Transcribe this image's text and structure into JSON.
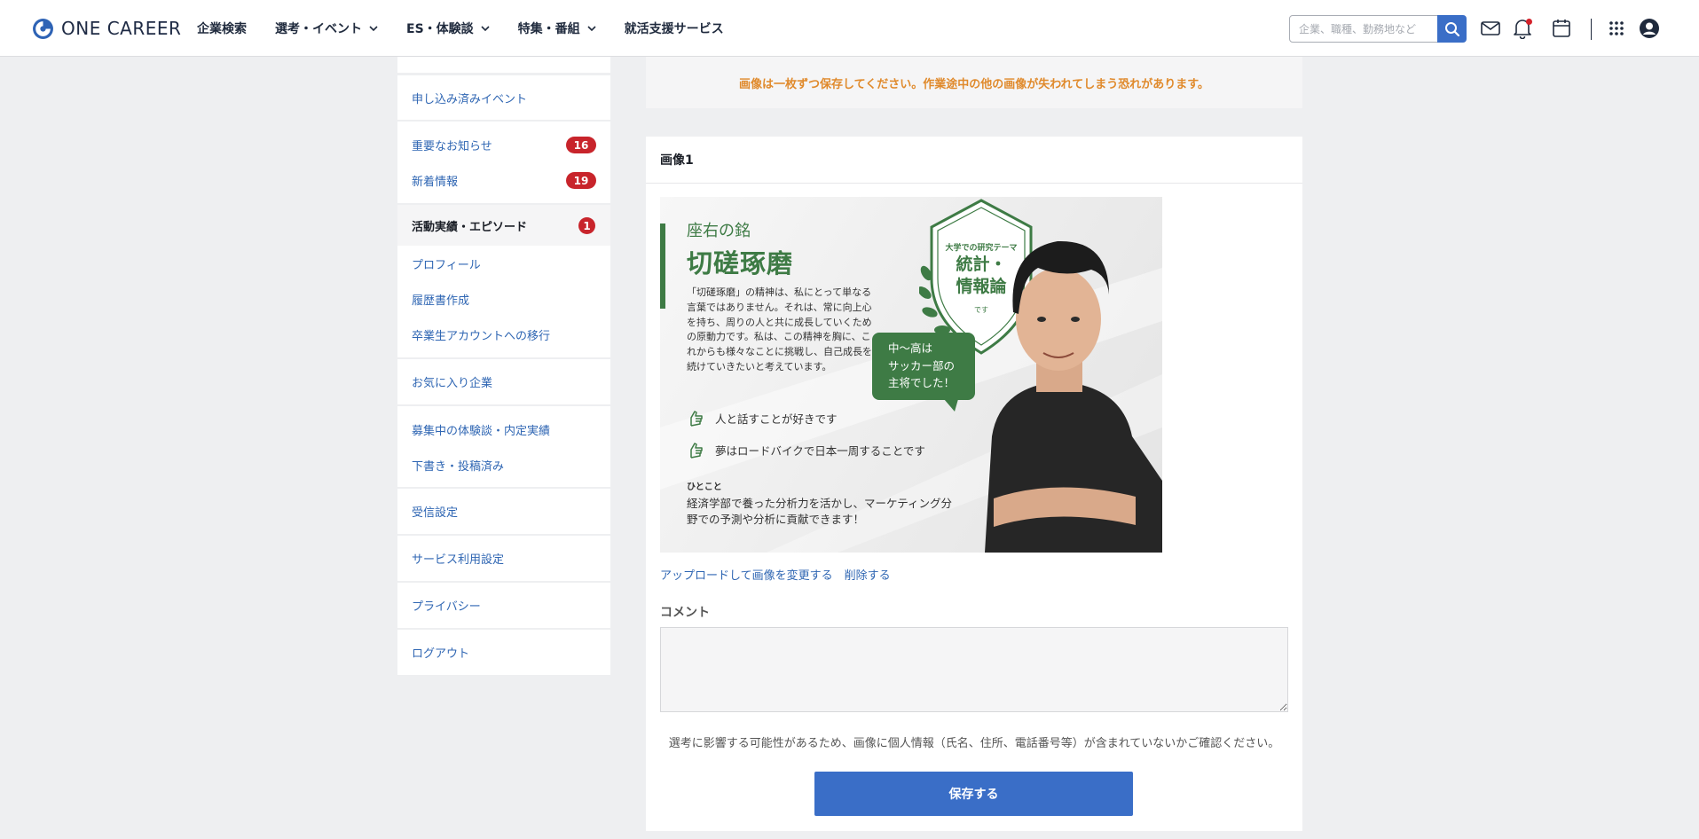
{
  "header": {
    "logo_text": "ONE CAREER",
    "nav": [
      {
        "label": "企業検索",
        "dropdown": false
      },
      {
        "label": "選考・イベント",
        "dropdown": true
      },
      {
        "label": "ES・体験談",
        "dropdown": true
      },
      {
        "label": "特集・番組",
        "dropdown": true
      },
      {
        "label": "就活支援サービス",
        "dropdown": false
      }
    ],
    "search_placeholder": "企業、職種、勤務地など",
    "icons": [
      "search-icon",
      "mail-icon",
      "bell-icon",
      "calendar-icon",
      "apps-grid-icon",
      "account-icon"
    ],
    "accent_color": "#3a6ec7",
    "notification_dot_color": "#d4222a"
  },
  "sidebar": {
    "items": [
      {
        "label": "申し込み済みイベント"
      },
      {
        "label": "重要なお知らせ",
        "badge": "16"
      },
      {
        "label": "新着情報",
        "badge": "19"
      },
      {
        "label": "活動実績・エピソード",
        "badge": "1",
        "active": true
      },
      {
        "label": "プロフィール"
      },
      {
        "label": "履歴書作成"
      },
      {
        "label": "卒業生アカウントへの移行"
      },
      {
        "label": "お気に入り企業"
      },
      {
        "label": "募集中の体験談・内定実績"
      },
      {
        "label": "下書き・投稿済み"
      },
      {
        "label": "受信設定"
      },
      {
        "label": "サービス利用設定"
      },
      {
        "label": "プライバシー"
      },
      {
        "label": "ログアウト"
      }
    ],
    "badge_color": "#c8242b"
  },
  "main": {
    "notice": "画像は一枚ずつ保存してください。作業途中の他の画像が失われてしまう恐れがあります。",
    "card_title": "画像1",
    "image": {
      "motto_label": "座右の銘",
      "motto": "切磋琢磨",
      "body": "「切磋琢磨」の精神は、私にとって単なる言葉ではありません。それは、常に向上心を持ち、周りの人と共に成長していくための原動力です。私は、この精神を胸に、これからも様々なことに挑戦し、自己成長を続けていきたいと考えています。",
      "likes": [
        "人と話すことが好きです",
        "夢はロードバイクで日本一周することです"
      ],
      "hitokoto_label": "ひとこと",
      "hitokoto": "経済学部で養った分析力を活かし、マーケティング分野での予測や分析に貢献できます！",
      "shield_small": "大学での研究テーマ",
      "shield_big_1": "統計・",
      "shield_big_2": "情報論",
      "shield_desu": "です",
      "bubble_1": "中〜高は",
      "bubble_2": "サッカー部の",
      "bubble_3": "主将でした！",
      "theme_color": "#3e7b45"
    },
    "upload_link": "アップロードして画像を変更する",
    "delete_link": "削除する",
    "comment_label": "コメント",
    "comment_value": "",
    "note": "選考に影響する可能性があるため、画像に個人情報（氏名、住所、電話番号等）が含まれていないかご確認ください。",
    "save_label": "保存する",
    "notice_color": "#e08a2c"
  }
}
